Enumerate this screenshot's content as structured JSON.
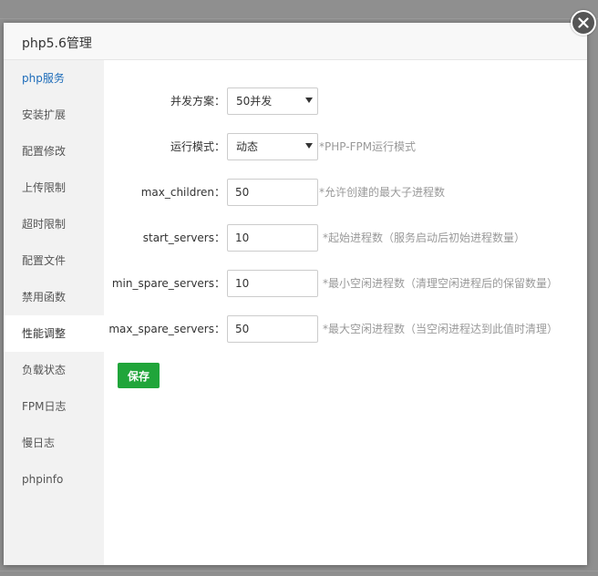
{
  "dialog": {
    "title": "php5.6管理"
  },
  "sidebar": {
    "items": [
      {
        "label": "php服务"
      },
      {
        "label": "安装扩展"
      },
      {
        "label": "配置修改"
      },
      {
        "label": "上传限制"
      },
      {
        "label": "超时限制"
      },
      {
        "label": "配置文件"
      },
      {
        "label": "禁用函数"
      },
      {
        "label": "性能调整"
      },
      {
        "label": "负载状态"
      },
      {
        "label": "FPM日志"
      },
      {
        "label": "慢日志"
      },
      {
        "label": "phpinfo"
      }
    ],
    "selected": "性能调整"
  },
  "form": {
    "concurrency": {
      "label": "并发方案：",
      "value": "50并发"
    },
    "run_mode": {
      "label": "运行模式：",
      "value": "动态",
      "hint": "*PHP-FPM运行模式"
    },
    "max_children": {
      "label": "max_children：",
      "value": "50",
      "hint": "*允许创建的最大子进程数"
    },
    "start_servers": {
      "label": "start_servers：",
      "value": "10",
      "hint": "*起始进程数（服务启动后初始进程数量）"
    },
    "min_spare_servers": {
      "label": "min_spare_servers：",
      "value": "10",
      "hint": "*最小空闲进程数（清理空闲进程后的保留数量）"
    },
    "max_spare_servers": {
      "label": "max_spare_servers：",
      "value": "50",
      "hint": "*最大空闲进程数（当空闲进程达到此值时清理）"
    },
    "save_label": "保存"
  },
  "colors": {
    "accent_green": "#20a53a",
    "active_blue": "#1f6dba",
    "hint_gray": "#999999"
  }
}
